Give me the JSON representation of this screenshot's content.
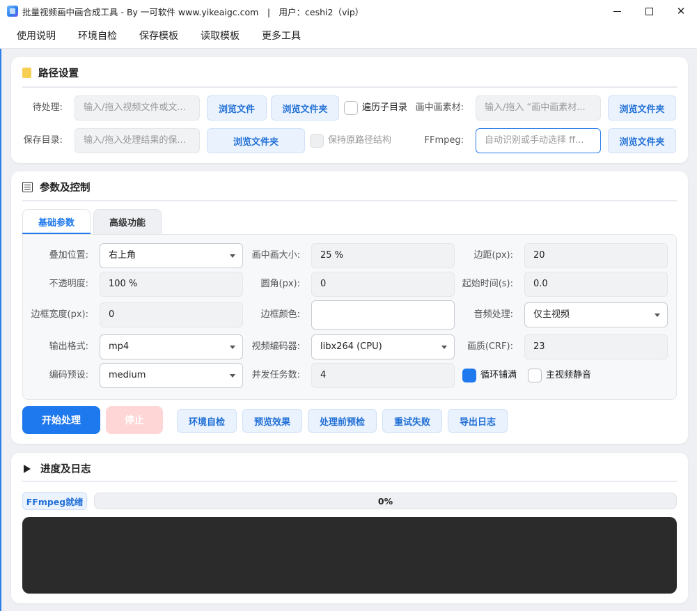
{
  "window": {
    "title": "批量视频画中画合成工具 - By 一可软件 www.yikeaigc.com　|　用户：ceshi2（vip）"
  },
  "menu": [
    "使用说明",
    "环境自检",
    "保存模板",
    "读取模板",
    "更多工具"
  ],
  "paths": {
    "title": "路径设置",
    "pending_label": "待处理:",
    "pending_placeholder": "输入/拖入视频文件或文...",
    "browse_file": "浏览文件",
    "browse_folder": "浏览文件夹",
    "recurse_label": "遍历子目录",
    "pip_label": "画中画素材:",
    "pip_placeholder": "输入/拖入 “画中画素材...",
    "save_label": "保存目录:",
    "save_placeholder": "输入/拖入处理结果的保...",
    "keep_structure_label": "保持原路径结构",
    "ffmpeg_label": "FFmpeg:",
    "ffmpeg_placeholder": "自动识别或手动选择 ff..."
  },
  "params": {
    "title": "参数及控制",
    "tabs": [
      "基础参数",
      "高级功能"
    ],
    "overlay_position_label": "叠加位置:",
    "overlay_position_value": "右上角",
    "pip_size_label": "画中画大小:",
    "pip_size_value": "25 %",
    "margin_label": "边距(px):",
    "margin_value": "20",
    "opacity_label": "不透明度:",
    "opacity_value": "100 %",
    "radius_label": "圆角(px):",
    "radius_value": "0",
    "start_time_label": "起始时间(s):",
    "start_time_value": "0.0",
    "border_width_label": "边框宽度(px):",
    "border_width_value": "0",
    "border_color_label": "边框颜色:",
    "audio_label": "音频处理:",
    "audio_value": "仅主视频",
    "format_label": "输出格式:",
    "format_value": "mp4",
    "encoder_label": "视频编码器:",
    "encoder_value": "libx264 (CPU)",
    "crf_label": "画质(CRF):",
    "crf_value": "23",
    "preset_label": "编码预设:",
    "preset_value": "medium",
    "concurrency_label": "并发任务数:",
    "concurrency_value": "4",
    "loop_fill_label": "循环铺满",
    "loop_fill_checked": true,
    "mute_main_label": "主视频静音",
    "mute_main_checked": false
  },
  "actions": {
    "start": "开始处理",
    "stop": "停止",
    "env_check": "环境自检",
    "preview": "预览效果",
    "precheck": "处理前预检",
    "retry": "重试失败",
    "export_log": "导出日志"
  },
  "progress": {
    "title": "进度及日志",
    "status": "FFmpeg就绪",
    "percent_text": "0%",
    "percent": 0
  },
  "colors": {
    "accent": "#1e78ee",
    "stop_disabled": "#ffd6d6",
    "log_bg": "#2b2b2b"
  }
}
